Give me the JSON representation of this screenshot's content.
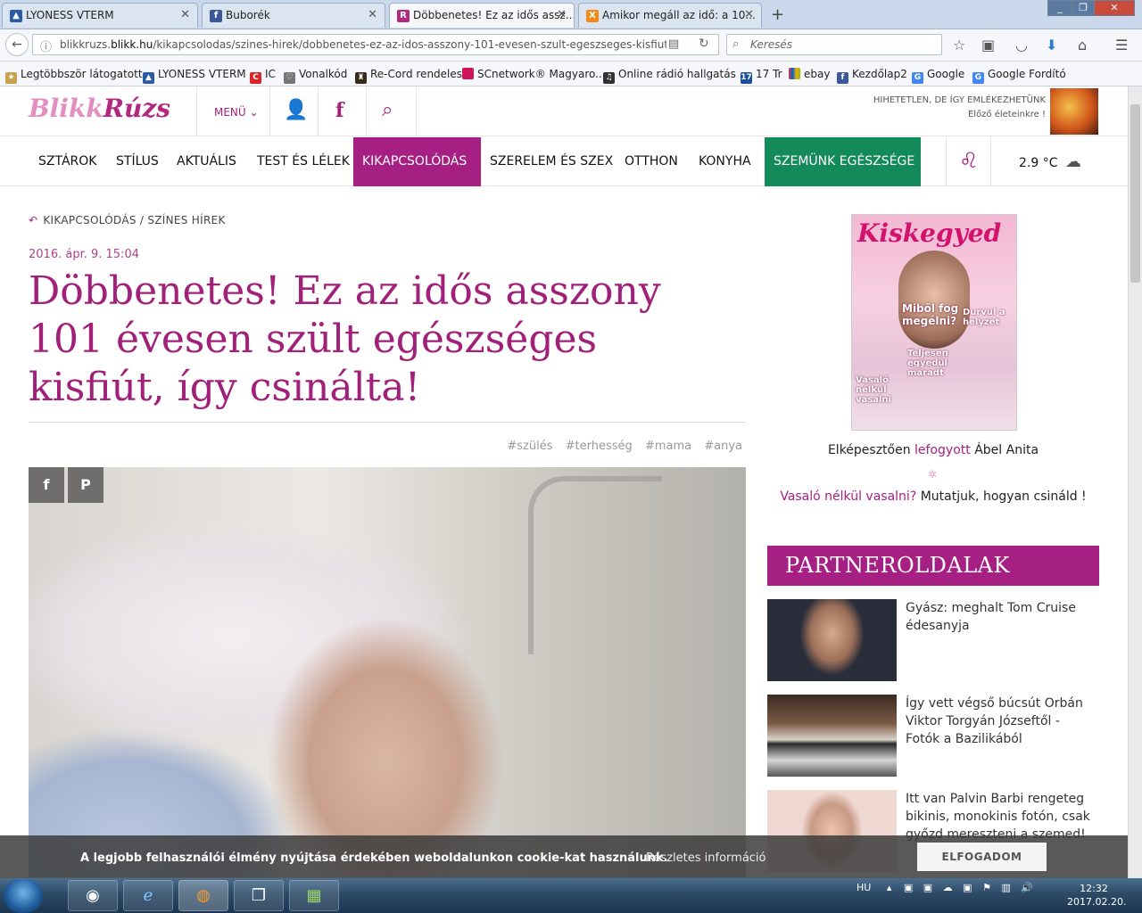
{
  "browser": {
    "tabs": [
      {
        "title": "LYONESS VTERM",
        "icon_color": "#2b5aa6"
      },
      {
        "title": "Buborék",
        "icon_color": "#3b5998"
      },
      {
        "title": "Döbbenetes! Ez az idős assz...",
        "icon_color": "#b2287f"
      },
      {
        "title": "Amikor megáll az idő: a 10...",
        "icon_color": "#f28c1a"
      }
    ],
    "new_tab": "+",
    "url_prefix": "blikkruzs.",
    "url_domain": "blikk.hu",
    "url_path": "/kikapcsolodas/szines-hirek/dobbenetes-ez-az-idos-asszony-101-evesen-szult-egeszseges-kisfiut-igy-csina",
    "search_placeholder": "Keresés",
    "bookmarks": [
      "Legtöbbször látogatott",
      "LYONESS VTERM",
      "IC",
      "Vonalkód",
      "Re-Cord rendeles",
      "SCnetwork® Magyaro...",
      "Online rádió hallgatás ...",
      "17 Tr",
      "ebay",
      "Kezdőlap2",
      "Google",
      "Google Fordító"
    ]
  },
  "site": {
    "logo_left": "Blikk",
    "logo_right": "Rúzs",
    "menu_label": "MENÜ",
    "promo_line1": "HIHETETLEN, DE ÍGY EMLÉKEZHETÜNK",
    "promo_line2": "Előző életeinkre !",
    "nav": [
      "SZTÁROK",
      "STÍLUS",
      "AKTUÁLIS",
      "TEST ÉS LÉLEK",
      "KIKAPCSOLÓDÁS",
      "SZERELEM ÉS SZEX",
      "OTTHON",
      "KONYHA",
      "SZEMÜNK EGÉSZSÉGE"
    ],
    "weather": "2.9 °C",
    "accent": "#a61f83",
    "green": "#138a59"
  },
  "article": {
    "breadcrumb": "KIKAPCSOLÓDÁS / SZÍNES HÍREK",
    "date": "2016. ápr. 9. 15:04",
    "title": "Döbbenetes! Ez az idős asszony 101 évesen szült egészséges kisfiút, így csinálta!",
    "tags": [
      "#szülés",
      "#terhesség",
      "#mama",
      "#anya"
    ],
    "share_facebook": "f",
    "share_pinterest": "P"
  },
  "sidebar": {
    "magazine_title": "Kiskegyed",
    "magazine_lines": [
      "Miből fog megélni?",
      "Durvul a helyzet",
      "Teljesen egyedül maradt",
      "Vasaló nélkül vasalni"
    ],
    "caption1_pre": "Elképesztően ",
    "caption1_hl": "lefogyott",
    "caption1_post": " Ábel Anita",
    "caption2_hl": "Vasaló nélkül vasalni?",
    "caption2_post": " Mutatjuk, hogyan csináld !",
    "partners_heading": "PARTNEROLDALAK",
    "partners": [
      {
        "text": "Gyász: meghalt Tom Cruise édesanyja"
      },
      {
        "text": "Így vett végső búcsút Orbán Viktor Torgyán Józseftől - Fotók a Bazilikából"
      },
      {
        "text": "Itt van Palvin Barbi rengeteg bikinis, monokinis fotón, csak győzd mereszteni a szemed!"
      }
    ]
  },
  "cookie": {
    "message": "A legjobb felhasználói élmény nyújtása érdekében weboldalunkon cookie-kat használunk.",
    "more": "Részletes információ",
    "accept": "ELFOGADOM"
  },
  "taskbar": {
    "lang": "HU",
    "time": "12:32",
    "date": "2017.02.20."
  }
}
